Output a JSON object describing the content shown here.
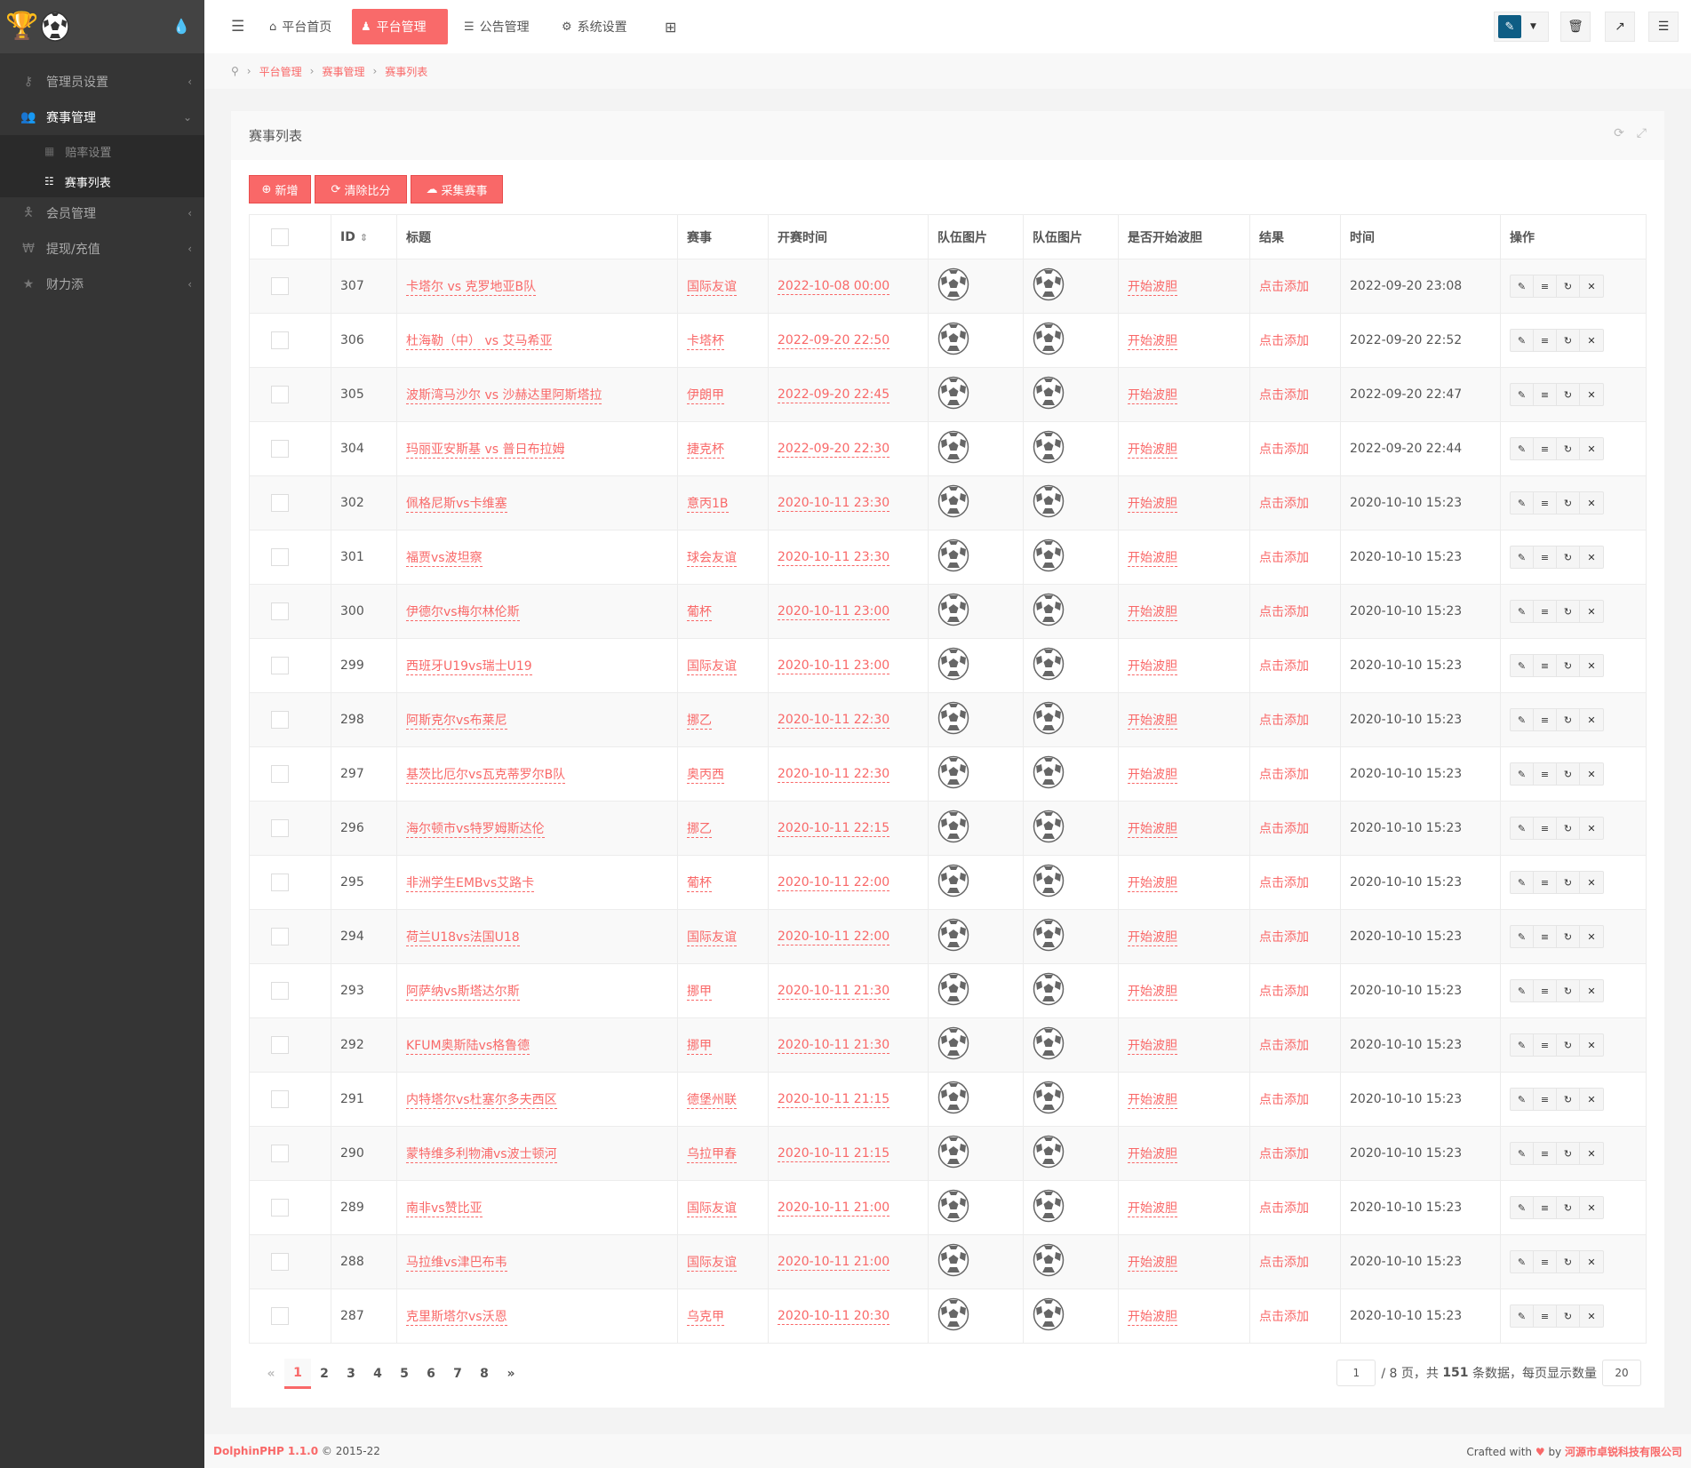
{
  "sidebar": {
    "items": [
      {
        "label": "管理员设置",
        "icon": "key-icon"
      },
      {
        "label": "赛事管理",
        "icon": "users-icon"
      },
      {
        "label": "会员管理",
        "icon": "user-icon"
      },
      {
        "label": "提现/充值",
        "icon": "won-icon"
      },
      {
        "label": "财力添",
        "icon": "star-icon"
      }
    ],
    "sub_items": [
      {
        "label": "赔率设置"
      },
      {
        "label": "赛事列表"
      }
    ]
  },
  "header": {
    "nav": [
      {
        "label": "平台首页"
      },
      {
        "label": "平台管理"
      },
      {
        "label": "公告管理"
      },
      {
        "label": "系统设置"
      }
    ]
  },
  "breadcrumb": [
    "平台管理",
    "赛事管理",
    "赛事列表"
  ],
  "panel": {
    "title": "赛事列表",
    "buttons": {
      "add": "新增",
      "clear": "清除比分",
      "collect": "采集赛事"
    }
  },
  "table": {
    "headers": [
      "ID",
      "标题",
      "赛事",
      "开赛时间",
      "队伍图片",
      "队伍图片",
      "是否开始波胆",
      "结果",
      "时间",
      "操作"
    ],
    "rows": [
      {
        "id": "307",
        "title": "卡塔尔 vs 克罗地亚B队",
        "league": "国际友谊",
        "start": "2022-10-08 00:00",
        "bodan": "开始波胆",
        "result": "点击添加",
        "time": "2022-09-20 23:08"
      },
      {
        "id": "306",
        "title": "杜海勒（中） vs 艾马希亚",
        "league": "卡塔杯",
        "start": "2022-09-20 22:50",
        "bodan": "开始波胆",
        "result": "点击添加",
        "time": "2022-09-20 22:52"
      },
      {
        "id": "305",
        "title": "波斯湾马沙尔 vs 沙赫达里阿斯塔拉",
        "league": "伊朗甲",
        "start": "2022-09-20 22:45",
        "bodan": "开始波胆",
        "result": "点击添加",
        "time": "2022-09-20 22:47"
      },
      {
        "id": "304",
        "title": "玛丽亚安斯基 vs 普日布拉姆",
        "league": "捷克杯",
        "start": "2022-09-20 22:30",
        "bodan": "开始波胆",
        "result": "点击添加",
        "time": "2022-09-20 22:44"
      },
      {
        "id": "302",
        "title": "佩格尼斯vs卡维塞",
        "league": "意丙1B",
        "start": "2020-10-11 23:30",
        "bodan": "开始波胆",
        "result": "点击添加",
        "time": "2020-10-10 15:23"
      },
      {
        "id": "301",
        "title": "福贾vs波坦察",
        "league": "球会友谊",
        "start": "2020-10-11 23:30",
        "bodan": "开始波胆",
        "result": "点击添加",
        "time": "2020-10-10 15:23"
      },
      {
        "id": "300",
        "title": "伊德尔vs梅尔林伦斯",
        "league": "葡杯",
        "start": "2020-10-11 23:00",
        "bodan": "开始波胆",
        "result": "点击添加",
        "time": "2020-10-10 15:23"
      },
      {
        "id": "299",
        "title": "西班牙U19vs瑞士U19",
        "league": "国际友谊",
        "start": "2020-10-11 23:00",
        "bodan": "开始波胆",
        "result": "点击添加",
        "time": "2020-10-10 15:23"
      },
      {
        "id": "298",
        "title": "阿斯克尔vs布莱尼",
        "league": "挪乙",
        "start": "2020-10-11 22:30",
        "bodan": "开始波胆",
        "result": "点击添加",
        "time": "2020-10-10 15:23"
      },
      {
        "id": "297",
        "title": "基茨比厄尔vs瓦克蒂罗尔B队",
        "league": "奥丙西",
        "start": "2020-10-11 22:30",
        "bodan": "开始波胆",
        "result": "点击添加",
        "time": "2020-10-10 15:23"
      },
      {
        "id": "296",
        "title": "海尔顿市vs特罗姆斯达伦",
        "league": "挪乙",
        "start": "2020-10-11 22:15",
        "bodan": "开始波胆",
        "result": "点击添加",
        "time": "2020-10-10 15:23"
      },
      {
        "id": "295",
        "title": "非洲学生EMBvs艾路卡",
        "league": "葡杯",
        "start": "2020-10-11 22:00",
        "bodan": "开始波胆",
        "result": "点击添加",
        "time": "2020-10-10 15:23"
      },
      {
        "id": "294",
        "title": "荷兰U18vs法国U18",
        "league": "国际友谊",
        "start": "2020-10-11 22:00",
        "bodan": "开始波胆",
        "result": "点击添加",
        "time": "2020-10-10 15:23"
      },
      {
        "id": "293",
        "title": "阿萨纳vs斯塔达尔斯",
        "league": "挪甲",
        "start": "2020-10-11 21:30",
        "bodan": "开始波胆",
        "result": "点击添加",
        "time": "2020-10-10 15:23"
      },
      {
        "id": "292",
        "title": "KFUM奥斯陆vs格鲁德",
        "league": "挪甲",
        "start": "2020-10-11 21:30",
        "bodan": "开始波胆",
        "result": "点击添加",
        "time": "2020-10-10 15:23"
      },
      {
        "id": "291",
        "title": "内特塔尔vs杜塞尔多夫西区",
        "league": "德堡州联",
        "start": "2020-10-11 21:15",
        "bodan": "开始波胆",
        "result": "点击添加",
        "time": "2020-10-10 15:23"
      },
      {
        "id": "290",
        "title": "蒙特维多利物浦vs波士顿河",
        "league": "乌拉甲春",
        "start": "2020-10-11 21:15",
        "bodan": "开始波胆",
        "result": "点击添加",
        "time": "2020-10-10 15:23"
      },
      {
        "id": "289",
        "title": "南非vs赞比亚",
        "league": "国际友谊",
        "start": "2020-10-11 21:00",
        "bodan": "开始波胆",
        "result": "点击添加",
        "time": "2020-10-10 15:23"
      },
      {
        "id": "288",
        "title": "马拉维vs津巴布韦",
        "league": "国际友谊",
        "start": "2020-10-11 21:00",
        "bodan": "开始波胆",
        "result": "点击添加",
        "time": "2020-10-10 15:23"
      },
      {
        "id": "287",
        "title": "克里斯塔尔vs沃恩",
        "league": "乌克甲",
        "start": "2020-10-11 20:30",
        "bodan": "开始波胆",
        "result": "点击添加",
        "time": "2020-10-10 15:23"
      }
    ]
  },
  "pagination": {
    "prev": "«",
    "next": "»",
    "pages": [
      "1",
      "2",
      "3",
      "4",
      "5",
      "6",
      "7",
      "8"
    ],
    "current": "1",
    "page_input": "1",
    "total_pages_text": "/ 8 页，共",
    "total_count": "151",
    "count_suffix": "条数据，每页显示数量",
    "per_page": "20"
  },
  "footer": {
    "brand": "DolphinPHP 1.1.0",
    "copyright": "© 2015-22",
    "crafted": "Crafted with",
    "by": "by",
    "company": "河源市卓锐科技有限公司"
  },
  "colors": {
    "accent": "#f96868",
    "sidebar": "#353535"
  }
}
